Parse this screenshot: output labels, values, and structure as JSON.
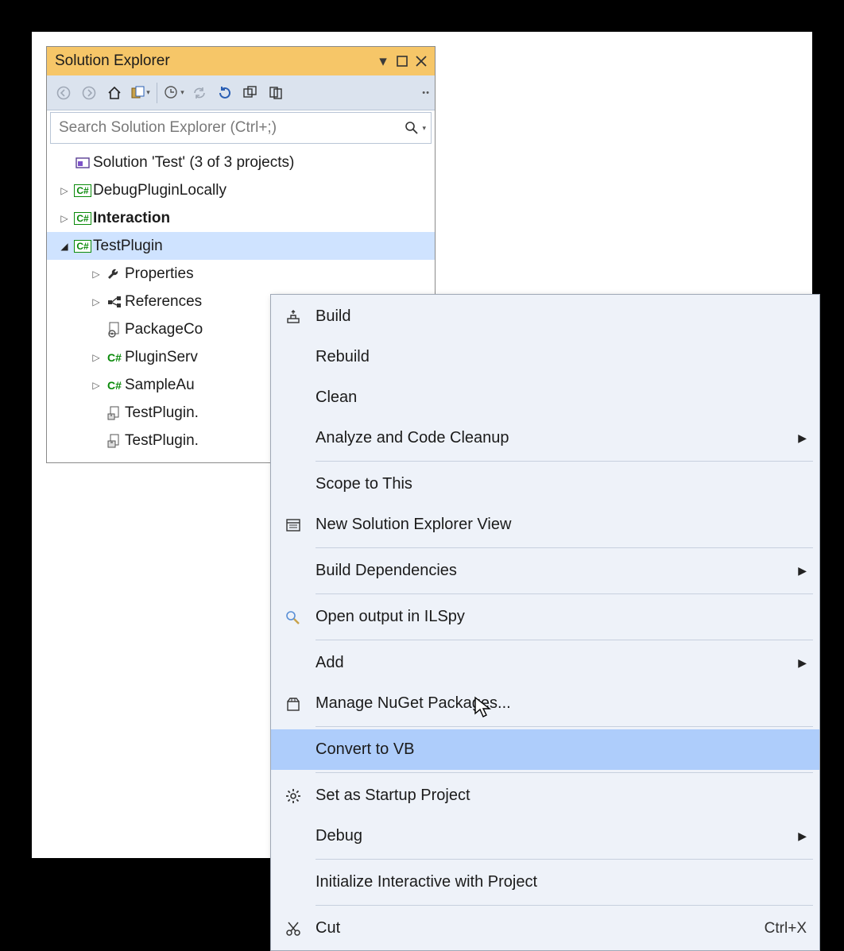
{
  "panel": {
    "title": "Solution Explorer",
    "search_placeholder": "Search Solution Explorer (Ctrl+;)"
  },
  "tree": {
    "solution_label": "Solution 'Test' (3 of 3 projects)",
    "projects": [
      {
        "name": "DebugPluginLocally",
        "bold": false,
        "expanded": false
      },
      {
        "name": "Interaction",
        "bold": true,
        "expanded": false
      },
      {
        "name": "TestPlugin",
        "bold": false,
        "expanded": true,
        "selected": true
      }
    ],
    "testplugin_children": [
      {
        "label": "Properties",
        "icon": "wrench",
        "expandable": true
      },
      {
        "label": "References",
        "icon": "refs",
        "expandable": true
      },
      {
        "label": "PackageCo",
        "icon": "pkgcfg",
        "expandable": false
      },
      {
        "label": "PluginServ",
        "icon": "csfile",
        "expandable": true
      },
      {
        "label": "SampleAu",
        "icon": "csfile",
        "expandable": true
      },
      {
        "label": "TestPlugin.",
        "icon": "csx1",
        "expandable": false
      },
      {
        "label": "TestPlugin.",
        "icon": "csx2",
        "expandable": false
      }
    ]
  },
  "context_menu": {
    "groups": [
      [
        {
          "label": "Build",
          "icon": "build"
        },
        {
          "label": "Rebuild"
        },
        {
          "label": "Clean"
        },
        {
          "label": "Analyze and Code Cleanup",
          "submenu": true
        }
      ],
      [
        {
          "label": "Scope to This"
        },
        {
          "label": "New Solution Explorer View",
          "icon": "newview"
        }
      ],
      [
        {
          "label": "Build Dependencies",
          "submenu": true
        }
      ],
      [
        {
          "label": "Open output in ILSpy",
          "icon": "ilspy"
        }
      ],
      [
        {
          "label": "Add",
          "submenu": true
        },
        {
          "label": "Manage NuGet Packages...",
          "icon": "nuget"
        }
      ],
      [
        {
          "label": "Convert to VB",
          "hover": true
        }
      ],
      [
        {
          "label": "Set as Startup Project",
          "icon": "gear"
        },
        {
          "label": "Debug",
          "submenu": true
        }
      ],
      [
        {
          "label": "Initialize Interactive with Project"
        }
      ],
      [
        {
          "label": "Cut",
          "icon": "cut",
          "shortcut": "Ctrl+X"
        }
      ]
    ]
  }
}
